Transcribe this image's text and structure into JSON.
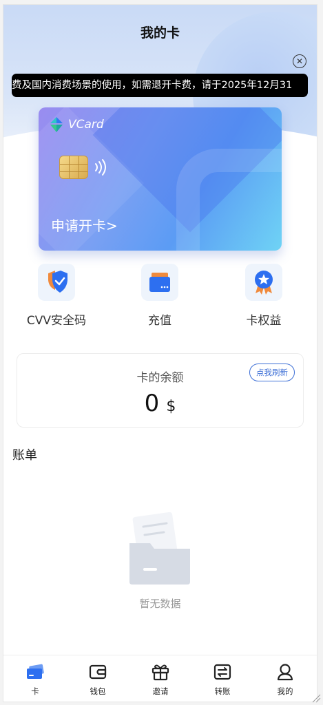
{
  "header": {
    "title": "我的卡"
  },
  "notice": {
    "text": "费及国内消费场景的使用，如需退开卡费，请于2025年12月31"
  },
  "card": {
    "brand": "VCard",
    "apply_label": "申请开卡>"
  },
  "actions": [
    {
      "label": "CVV安全码",
      "icon": "shield-check-icon"
    },
    {
      "label": "充值",
      "icon": "card-topup-icon"
    },
    {
      "label": "卡权益",
      "icon": "award-badge-icon"
    }
  ],
  "balance": {
    "title": "卡的余额",
    "value": "0",
    "currency": "$",
    "refresh_label": "点我刷新"
  },
  "bill": {
    "title": "账单",
    "empty_text": "暂无数据"
  },
  "tabbar": [
    {
      "label": "卡",
      "icon": "card-icon",
      "active": true
    },
    {
      "label": "钱包",
      "icon": "wallet-icon",
      "active": false
    },
    {
      "label": "邀请",
      "icon": "gift-icon",
      "active": false
    },
    {
      "label": "转账",
      "icon": "transfer-icon",
      "active": false
    },
    {
      "label": "我的",
      "icon": "user-icon",
      "active": false
    }
  ],
  "colors": {
    "accent": "#3d6fd6",
    "card_start": "#9a8cf0",
    "card_end": "#6fd3f5"
  }
}
